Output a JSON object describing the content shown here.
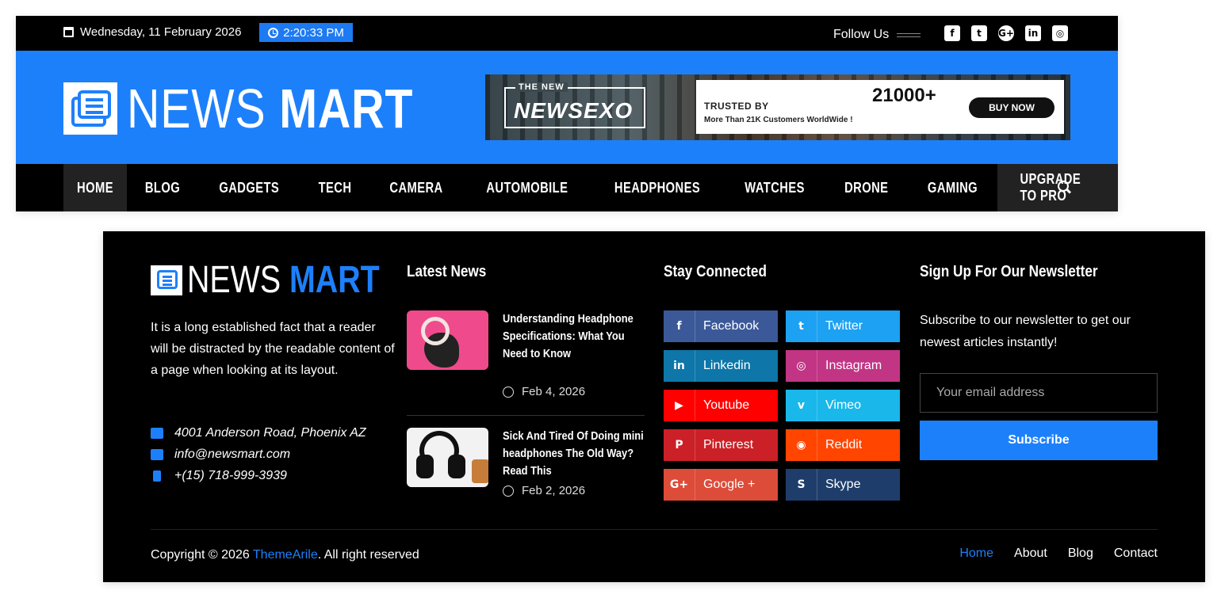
{
  "topbar": {
    "date": "Wednesday, 11 February 2026",
    "time": "2:20:33 PM",
    "follow_label": "Follow Us",
    "socials": [
      "facebook-icon",
      "twitter-icon",
      "google-plus-icon",
      "linkedin-icon",
      "instagram-icon"
    ],
    "social_glyphs": [
      "f",
      "t",
      "G+",
      "in",
      "◎"
    ]
  },
  "brand": {
    "name_part1": "NEWS",
    "name_part2": "MART",
    "color": "#1d80fb"
  },
  "ad": {
    "badge_small": "THE NEW",
    "badge_big": "NEWSEXO",
    "trusted": "TRUSTED BY",
    "more": "More Than 21K Customers WorldWide !",
    "count": "21000+",
    "buy": "BUY NOW"
  },
  "nav": {
    "items": [
      "HOME",
      "BLOG",
      "GADGETS",
      "TECH",
      "CAMERA",
      "AUTOMOBILE",
      "HEADPHONES",
      "WATCHES",
      "DRONE",
      "GAMING",
      "UPGRADE TO PRO"
    ]
  },
  "footer": {
    "logo_part1": "NEWS",
    "logo_part2": "MART",
    "about": "It is a long established fact that a reader will be distracted by the readable content of a page when looking at its layout.",
    "address": "4001 Anderson Road, Phoenix AZ",
    "email": "info@newsmart.com",
    "phone": "+(15) 718-999-3939",
    "latest_title": "Latest News",
    "news": [
      {
        "title": "Understanding Headphone Specifications: What You Need to Know",
        "date": "Feb 4, 2026"
      },
      {
        "title": "Sick And Tired Of Doing mini headphones The Old Way? Read This",
        "date": "Feb 2, 2026"
      }
    ],
    "connected_title": "Stay Connected",
    "social_buttons": [
      {
        "label": "Facebook",
        "glyph": "f",
        "icon": "facebook-icon",
        "color": "#3b5998"
      },
      {
        "label": "Twitter",
        "glyph": "t",
        "icon": "twitter-icon",
        "color": "#1da1f2"
      },
      {
        "label": "Linkedin",
        "glyph": "in",
        "icon": "linkedin-icon",
        "color": "#0e76a8"
      },
      {
        "label": "Instagram",
        "glyph": "◎",
        "icon": "instagram-icon",
        "color": "#c13584"
      },
      {
        "label": "Youtube",
        "glyph": "▶",
        "icon": "youtube-icon",
        "color": "#ff0000"
      },
      {
        "label": "Vimeo",
        "glyph": "v",
        "icon": "vimeo-icon",
        "color": "#1ab7ea"
      },
      {
        "label": "Pinterest",
        "glyph": "P",
        "icon": "pinterest-icon",
        "color": "#cb2027"
      },
      {
        "label": "Reddit",
        "glyph": "◉",
        "icon": "reddit-icon",
        "color": "#ff4500"
      },
      {
        "label": "Google +",
        "glyph": "G+",
        "icon": "google-plus-icon",
        "color": "#dd4b39"
      },
      {
        "label": "Skype",
        "glyph": "S",
        "icon": "skype-icon",
        "color": "#1e3d6b"
      }
    ],
    "newsletter_title": "Sign Up For Our Newsletter",
    "newsletter_text": "Subscribe to our newsletter to get our newest articles instantly!",
    "email_placeholder": "Your email address",
    "subscribe_label": "Subscribe",
    "copyright_prefix": "Copyright © 2026 ",
    "copyright_link": "ThemeArile",
    "copyright_suffix": ". All right reserved",
    "links": [
      "Home",
      "About",
      "Blog",
      "Contact"
    ]
  }
}
